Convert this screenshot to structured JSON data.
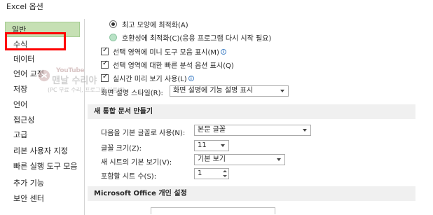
{
  "window": {
    "title": "Excel 옵션"
  },
  "sidebar": {
    "items": [
      {
        "label": "일반"
      },
      {
        "label": "수식"
      },
      {
        "label": "데이터"
      },
      {
        "label": "언어 교정"
      },
      {
        "label": "저장"
      },
      {
        "label": "언어"
      },
      {
        "label": "접근성"
      },
      {
        "label": "고급"
      },
      {
        "label": "리본 사용자 지정"
      },
      {
        "label": "빠른 실행 도구 모음"
      },
      {
        "label": "추가 기능"
      },
      {
        "label": "보안 센터"
      }
    ],
    "selected": "일반",
    "highlighted": "수식"
  },
  "watermark": {
    "small": "YouTube",
    "big": "맨날 수리야",
    "sub": "(PC 무료 수리, 프로그램 사용법)"
  },
  "general": {
    "radio_best_appearance": "최고 모양에 최적화(A)",
    "radio_compat": "호환성에 최적화(C)(응용 프로그램 다시 시작 필요)",
    "chk_mini_toolbar": "선택 영역에 미니 도구 모음 표시(M)",
    "chk_quick_analysis": "선택 영역에 대한 빠른 분석 옵션 표시(Q)",
    "chk_live_preview": "실시간 미리 보기 사용(L)",
    "screentip_label": "화면 설명 스타일(R):",
    "screentip_value": "화면 설명에 기능 설명 표시"
  },
  "new_workbook": {
    "header": "새 통합 문서 만들기",
    "font_label": "다음을 기본 글꼴로 사용(N):",
    "font_value": "본문 글꼴",
    "size_label": "글꼴 크기(Z):",
    "size_value": "11",
    "view_label": "새 시트의 기본 보기(V):",
    "view_value": "기본 보기",
    "sheets_label": "포함할 시트 수(S):",
    "sheets_value": "1"
  },
  "personalize": {
    "header": "Microsoft Office 개인 설정"
  },
  "colors": {
    "selected_bg": "#c6e0b4",
    "highlight_box": "#ff0000",
    "section_bg": "#f0f0f0"
  }
}
